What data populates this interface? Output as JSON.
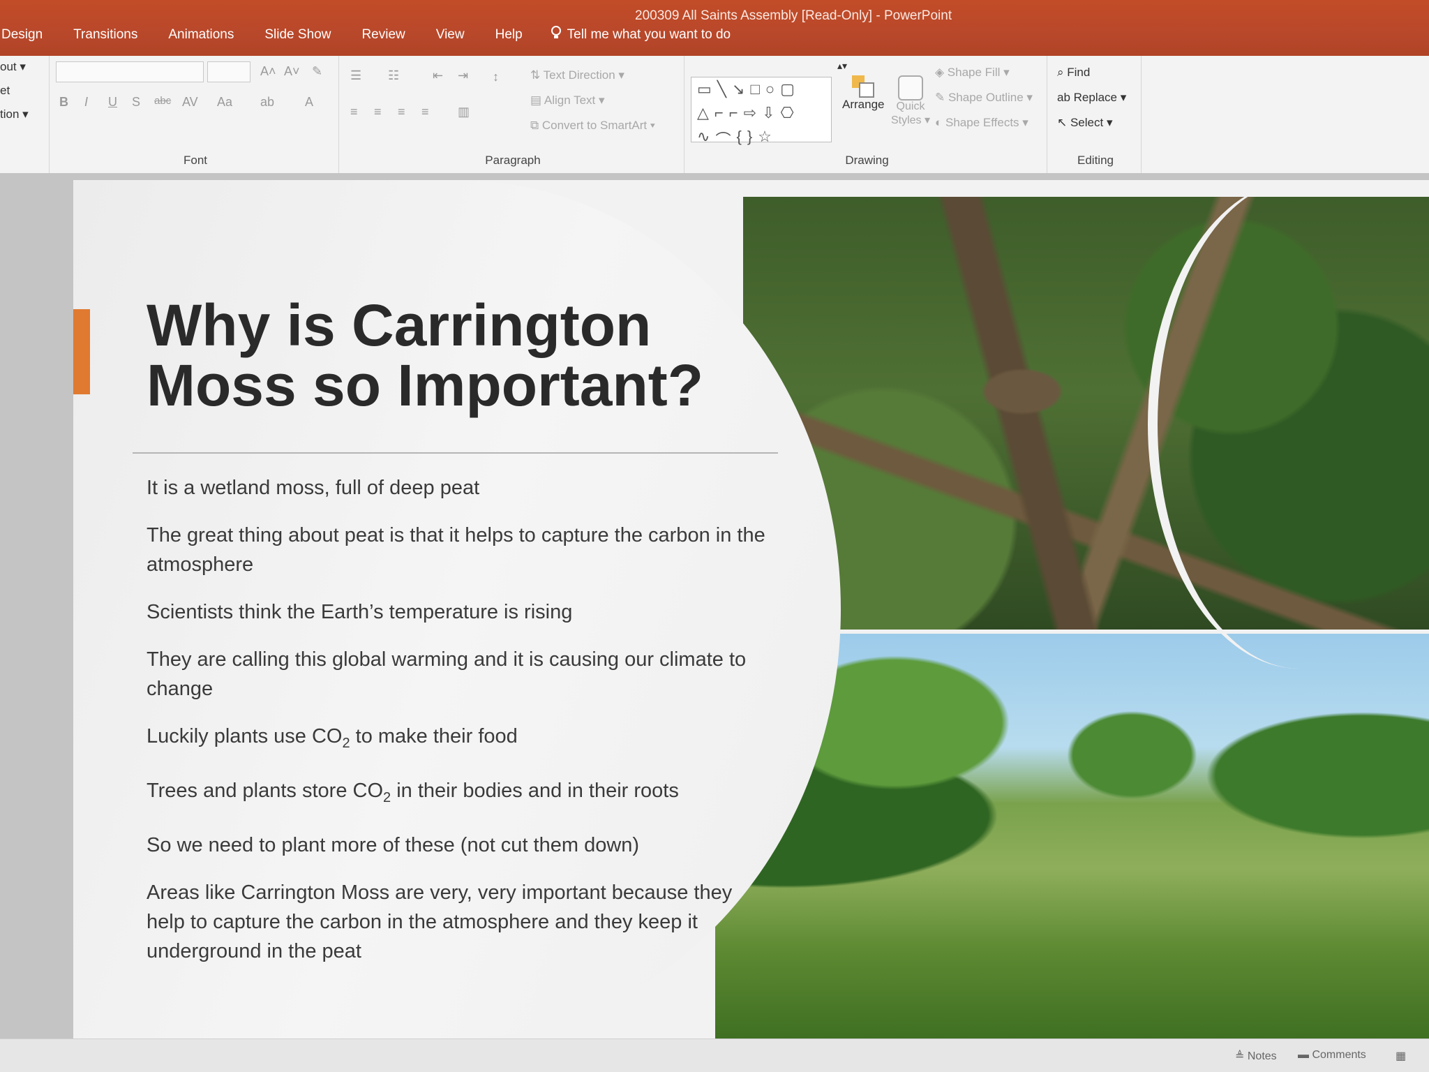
{
  "window": {
    "title": "200309 All Saints Assembly [Read-Only] - PowerPoint"
  },
  "tabs": [
    {
      "label": "Design"
    },
    {
      "label": "Transitions"
    },
    {
      "label": "Animations"
    },
    {
      "label": "Slide Show"
    },
    {
      "label": "Review"
    },
    {
      "label": "View"
    },
    {
      "label": "Help"
    }
  ],
  "tell_me": {
    "placeholder": "Tell me what you want to do"
  },
  "ribbon": {
    "slides_group": {
      "layout": "out ▾",
      "reset": "et",
      "section": "tion ▾"
    },
    "font_group": {
      "label": "Font",
      "bold": "B",
      "italic": "I",
      "underline": "U",
      "shadow": "S",
      "strike": "abc",
      "spacing": "AV",
      "case": "Aa",
      "grow": "A˄",
      "shrink": "A˅",
      "font_color": "A"
    },
    "paragraph_group": {
      "label": "Paragraph",
      "text_direction": "Text Direction ▾",
      "align_text": "Align Text ▾",
      "convert_smartart": "Convert to SmartArt ▾"
    },
    "drawing_group": {
      "label": "Drawing",
      "arrange": "Arrange",
      "quick_styles": "Quick Styles ▾",
      "shape_fill": "Shape Fill ▾",
      "shape_outline": "Shape Outline ▾",
      "shape_effects": "Shape Effects ▾"
    },
    "editing_group": {
      "label": "Editing",
      "find": "Find",
      "replace": "Replace ▾",
      "select": "Select ▾"
    }
  },
  "slide": {
    "title_line1": "Why is Carrington",
    "title_line2": "Moss so Important?",
    "bullets": [
      {
        "text": "It is a wetland moss, full of deep peat"
      },
      {
        "text": "The great thing about peat is that it helps to capture the carbon in the atmosphere"
      },
      {
        "text": "Scientists think the Earth’s temperature is rising"
      },
      {
        "text": "They are calling this global warming and it is causing our climate to change"
      },
      {
        "pre": "Luckily plants use CO",
        "sub": "2",
        "post": " to make their food"
      },
      {
        "pre": "Trees and plants store CO",
        "sub": "2",
        "post": " in their bodies and in their roots"
      },
      {
        "text": "So we need to plant more of these (not cut them down)"
      },
      {
        "text": "Areas like Carrington Moss are very, very important because they help to capture the carbon in the atmosphere and they keep it underground in the peat"
      }
    ]
  },
  "statusbar": {
    "notes": "Notes",
    "comments": "Comments"
  },
  "colors": {
    "title_bar": "#b7472a",
    "accent": "#e07a30"
  }
}
